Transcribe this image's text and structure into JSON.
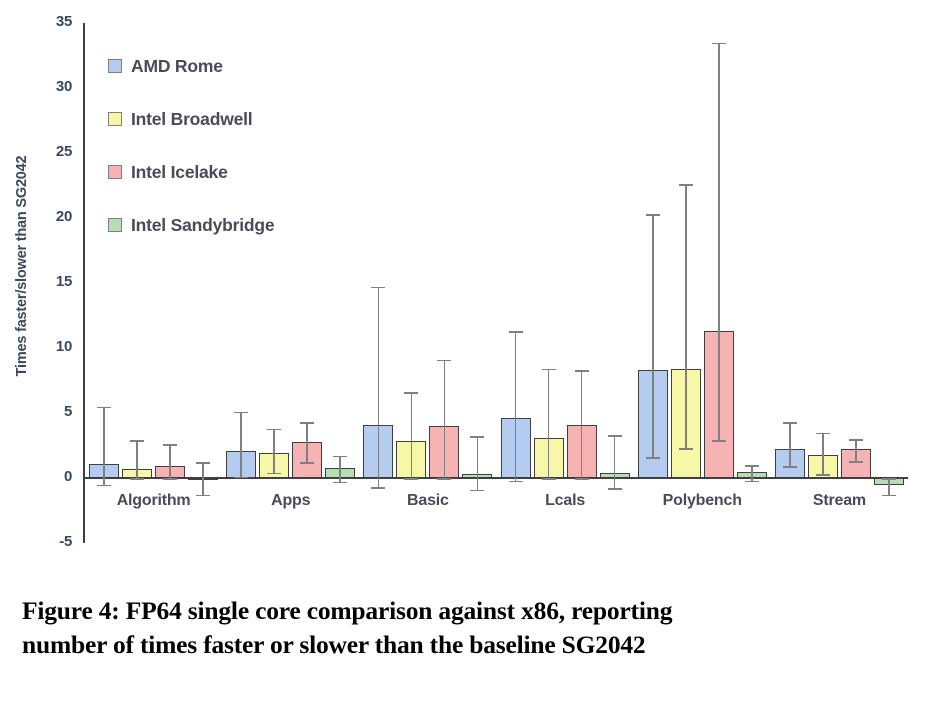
{
  "figure": {
    "caption_line1": "Figure 4: FP64 single core comparison against x86, reporting",
    "caption_line2": "number of times faster or slower than the baseline SG2042"
  },
  "chart_data": {
    "type": "bar",
    "title": "",
    "xlabel": "",
    "ylabel": "Times faster/slower than SG2042",
    "ylim": [
      -5,
      35
    ],
    "ytick_values": [
      35,
      30,
      25,
      20,
      15,
      10,
      5,
      0,
      -5
    ],
    "ytick_labels": [
      "35",
      "30",
      "25",
      "20",
      "15",
      "10",
      "5",
      "0",
      "-5"
    ],
    "grid": false,
    "legend_position": "upper-left-inside",
    "error_bars": true,
    "categories": [
      "Algorithm",
      "Apps",
      "Basic",
      "Lcals",
      "Polybench",
      "Stream"
    ],
    "series": [
      {
        "name": "AMD Rome",
        "color": "#b3ccf0",
        "values": [
          1.1,
          2.1,
          4.1,
          4.6,
          8.3,
          2.25
        ],
        "err_high": [
          5.5,
          5.1,
          14.7,
          11.3,
          20.3,
          4.3
        ],
        "err_low": [
          -0.5,
          0.1,
          -0.7,
          -0.2,
          1.6,
          0.9
        ]
      },
      {
        "name": "Intel Broadwell",
        "color": "#f7f7a8",
        "values": [
          0.7,
          1.9,
          2.85,
          3.05,
          8.4,
          1.8
        ],
        "err_high": [
          2.9,
          3.8,
          6.6,
          8.4,
          22.6,
          3.5
        ],
        "err_low": [
          0.0,
          0.4,
          0.0,
          0.0,
          2.3,
          0.3
        ]
      },
      {
        "name": "Intel Icelake",
        "color": "#f7b3b3",
        "values": [
          0.9,
          2.75,
          4.0,
          4.1,
          11.3,
          2.2
        ],
        "err_high": [
          2.6,
          4.3,
          9.1,
          8.3,
          33.5,
          3.0
        ],
        "err_low": [
          0.0,
          1.2,
          0.0,
          0.0,
          2.9,
          1.3
        ]
      },
      {
        "name": "Intel Sandybridge",
        "color": "#b7ddb4",
        "values": [
          -0.1,
          0.75,
          0.3,
          0.4,
          0.45,
          -0.5
        ],
        "err_high": [
          1.2,
          1.7,
          3.2,
          3.3,
          1.0,
          0.0
        ],
        "err_low": [
          -1.3,
          -0.3,
          -0.9,
          -0.8,
          -0.2,
          -1.3
        ]
      }
    ]
  }
}
